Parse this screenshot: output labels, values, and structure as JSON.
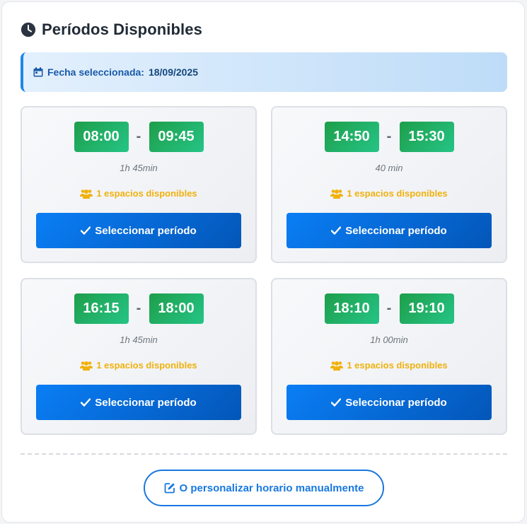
{
  "header": {
    "title": "Períodos Disponibles",
    "icon": "clock-icon"
  },
  "date_banner": {
    "label": "Fecha seleccionada:",
    "date": "18/09/2025",
    "icon": "calendar-icon"
  },
  "periods": [
    {
      "start": "08:00",
      "end": "09:45",
      "duration": "1h 45min",
      "spaces": "1 espacios disponibles",
      "button": "Seleccionar período"
    },
    {
      "start": "14:50",
      "end": "15:30",
      "duration": "40 min",
      "spaces": "1 espacios disponibles",
      "button": "Seleccionar período"
    },
    {
      "start": "16:15",
      "end": "18:00",
      "duration": "1h 45min",
      "spaces": "1 espacios disponibles",
      "button": "Seleccionar período"
    },
    {
      "start": "18:10",
      "end": "19:10",
      "duration": "1h 00min",
      "spaces": "1 espacios disponibles",
      "button": "Seleccionar período"
    }
  ],
  "time_separator": "-",
  "manual_button": {
    "label": "O personalizar horario manualmente",
    "icon": "edit-icon"
  },
  "colors": {
    "accent": "#0a7ef5",
    "time_green": "#1e9e4a",
    "spaces_yellow": "#f0b10c"
  }
}
